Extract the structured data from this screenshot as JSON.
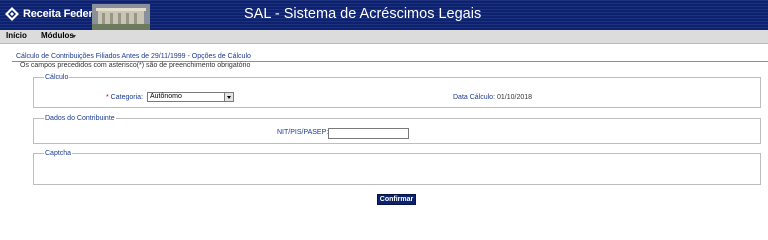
{
  "banner": {
    "logo_text": "Receita Federal",
    "title": "SAL - Sistema de Acréscimos Legais"
  },
  "menu": {
    "inicio": "Início",
    "modulos": "Módulos"
  },
  "page": {
    "title": "Cálculo de Contribuições Filiados Antes de 29/11/1999 - Opções de Cálculo",
    "subtitle": "Os campos precedidos com asterisco(*) são de preenchimento obrigatório"
  },
  "calculo": {
    "legend": "Cálculo",
    "categoria_star": "* ",
    "categoria_label": "Categoria:",
    "categoria_value": "Autônomo",
    "data_label": "Data Cálculo:",
    "data_value": "01/10/2018"
  },
  "contribuinte": {
    "legend": "Dados do Contribuinte",
    "nit_label": "NIT/PIS/PASEP:",
    "nit_value": ""
  },
  "captcha": {
    "legend": "Captcha"
  },
  "actions": {
    "confirmar": "Confirmar"
  },
  "colors": {
    "banner": "#0c2270",
    "label_blue": "#1a3b8f",
    "required": "#cc0000"
  }
}
